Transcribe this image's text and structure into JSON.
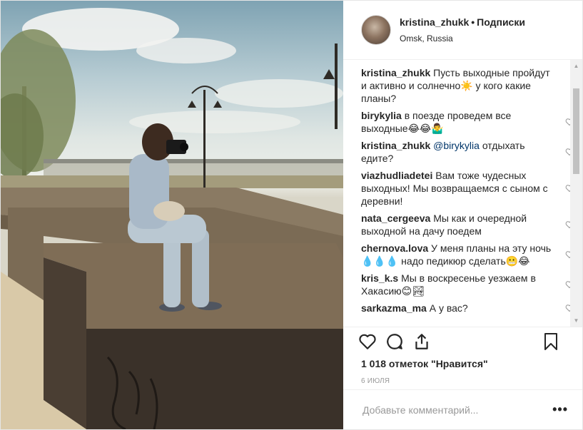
{
  "header": {
    "username": "kristina_zhukk",
    "dot": "•",
    "follow_label": "Подписки",
    "location": "Omsk, Russia"
  },
  "caption": {
    "username": "kristina_zhukk",
    "text": "Пусть выходные пройдут и активно и солнечно☀️ у кого какие планы?"
  },
  "comments": [
    {
      "username": "birykylia",
      "text": "в поезде проведем все выходные😂😂🤷‍♂️"
    },
    {
      "username": "kristina_zhukk",
      "mention": "@birykylia",
      "text": "отдыхать едите?"
    },
    {
      "username": "viazhudliadetei",
      "text": "Вам тоже чудесных выходных! Мы возвращаемся с сыном с деревни!"
    },
    {
      "username": "nata_cergeeva",
      "text": "Мы как и очередной выходной на дачу поедем"
    },
    {
      "username": "chernova.lova",
      "text": "У меня планы на эту ночь💧💧💧 надо педикюр сделать😬😂"
    },
    {
      "username": "kris_k.s",
      "text": "Мы в воскресенье уезжаем в Хакасию😊🏞"
    },
    {
      "username": "sarkazma_ma",
      "text": "А у вас?"
    }
  ],
  "icons": {
    "like": "heart-icon",
    "comment": "comment-icon",
    "share": "share-icon",
    "save": "bookmark-icon",
    "comment_like": "heart-icon"
  },
  "likes": "1 018 отметок \"Нравится\"",
  "date": "6 ИЮЛЯ",
  "add_comment": {
    "placeholder": "Добавьте комментарий..."
  },
  "more": "•••"
}
